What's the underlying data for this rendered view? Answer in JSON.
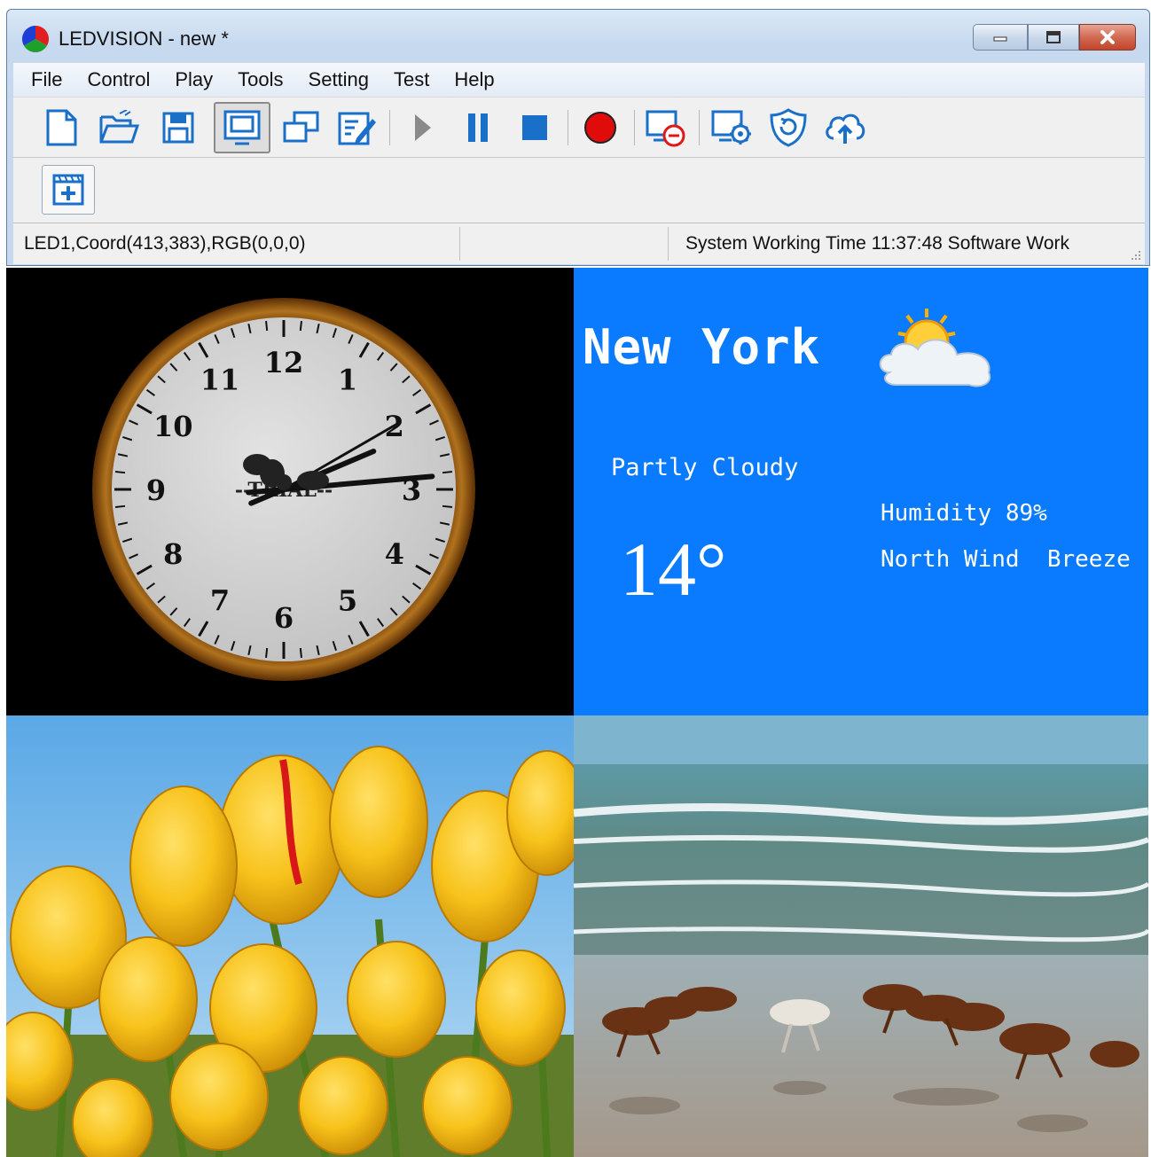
{
  "window": {
    "title": "LEDVISION - new *",
    "caption_buttons": [
      "minimize-icon",
      "restore-icon",
      "close-icon"
    ]
  },
  "menu": [
    "File",
    "Control",
    "Play",
    "Tools",
    "Setting",
    "Test",
    "Help"
  ],
  "toolbar": {
    "row1": [
      "new-file-icon",
      "open-folder-icon",
      "save-icon",
      "display-window-icon",
      "multi-window-icon",
      "edit-icon",
      "play-icon",
      "pause-icon",
      "stop-icon",
      "record-icon",
      "stop-display-icon",
      "screen-settings-icon",
      "shield-refresh-icon",
      "cloud-upload-icon"
    ],
    "row2": [
      "add-program-icon"
    ]
  },
  "status": {
    "left": "LED1,Coord(413,383),RGB(0,0,0)",
    "middle": "",
    "right": "System Working Time 11:37:48 Software Work"
  },
  "clock": {
    "numerals": [
      "12",
      "1",
      "2",
      "3",
      "4",
      "5",
      "6",
      "7",
      "8",
      "9",
      "10",
      "11"
    ],
    "brand": "--TRIAL--",
    "time": {
      "hour": 2,
      "minute": 14,
      "second": 10
    },
    "colors": {
      "face": "#d2d2d2",
      "rim": "#9a5a14",
      "hands": "#111111"
    }
  },
  "weather": {
    "city": "New York",
    "condition": "Partly Cloudy",
    "temperature": "14°",
    "humidity": "Humidity 89%",
    "wind": "North Wind  Breeze",
    "icon": "partly-cloudy-icon",
    "background": "#0a7bff"
  },
  "images": {
    "tulips": "yellow-tulips-photo",
    "horses": "horses-on-beach-photo"
  }
}
